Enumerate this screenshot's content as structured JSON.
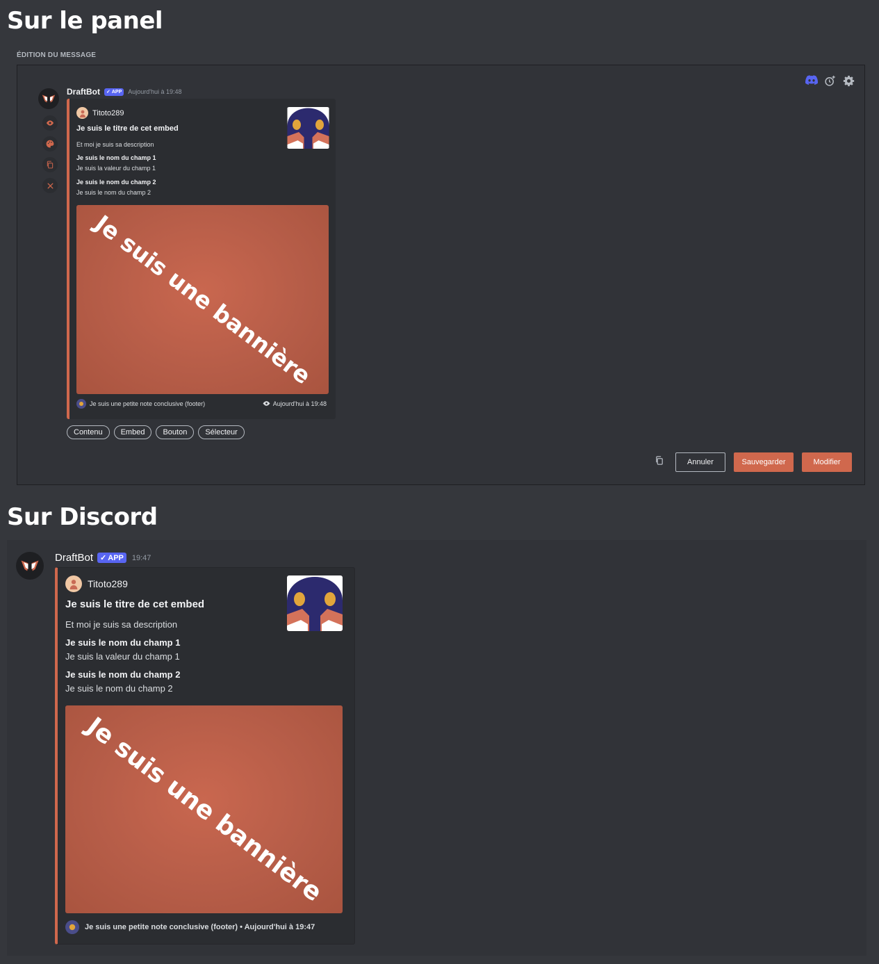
{
  "headings": {
    "panel": "Sur le panel",
    "discord": "Sur Discord"
  },
  "panel": {
    "label": "ÉDITION DU MESSAGE",
    "bot_name": "DraftBot",
    "badge": "APP",
    "timestamp": "Aujourd'hui à 19:48",
    "top_icons": [
      "discord-icon",
      "clock-plus-icon",
      "gear-icon"
    ],
    "side_icons": [
      "eye-icon",
      "palette-icon",
      "copy-icon",
      "close-icon"
    ],
    "embed": {
      "author": "Titoto289",
      "title": "Je suis le titre de cet embed",
      "description": "Et moi je suis sa description",
      "fields": [
        {
          "name": "Je suis le nom du champ 1",
          "value": "Je suis la valeur du champ 1"
        },
        {
          "name": "Je suis le nom du champ 2",
          "value": "Je suis le nom du champ 2"
        }
      ],
      "image_text": "Je suis une bannière",
      "footer": "Je suis une petite note conclusive (footer)",
      "footer_time": "Aujourd'hui à 19:48"
    },
    "tabs": [
      "Contenu",
      "Embed",
      "Bouton",
      "Sélecteur"
    ],
    "actions": {
      "cancel": "Annuler",
      "save": "Sauvegarder",
      "edit": "Modifier"
    }
  },
  "discord": {
    "bot_name": "DraftBot",
    "badge": "APP",
    "timestamp": "19:47",
    "embed": {
      "author": "Titoto289",
      "title": "Je suis le titre de cet embed",
      "description": "Et moi je suis sa description",
      "fields": [
        {
          "name": "Je suis le nom du champ 1",
          "value": "Je suis la valeur du champ 1"
        },
        {
          "name": "Je suis le nom du champ 2",
          "value": "Je suis le nom du champ 2"
        }
      ],
      "image_text": "Je suis une bannière",
      "footer": "Je suis une petite note conclusive (footer) • Aujourd'hui à 19:47"
    }
  },
  "colors": {
    "background": "#35373c",
    "panel": "#313338",
    "embed": "#2b2d31",
    "accent": "#d0684d",
    "blurple": "#5865f2",
    "thumb_navy": "#2c2a6e",
    "thumb_orange": "#e2a53b"
  }
}
